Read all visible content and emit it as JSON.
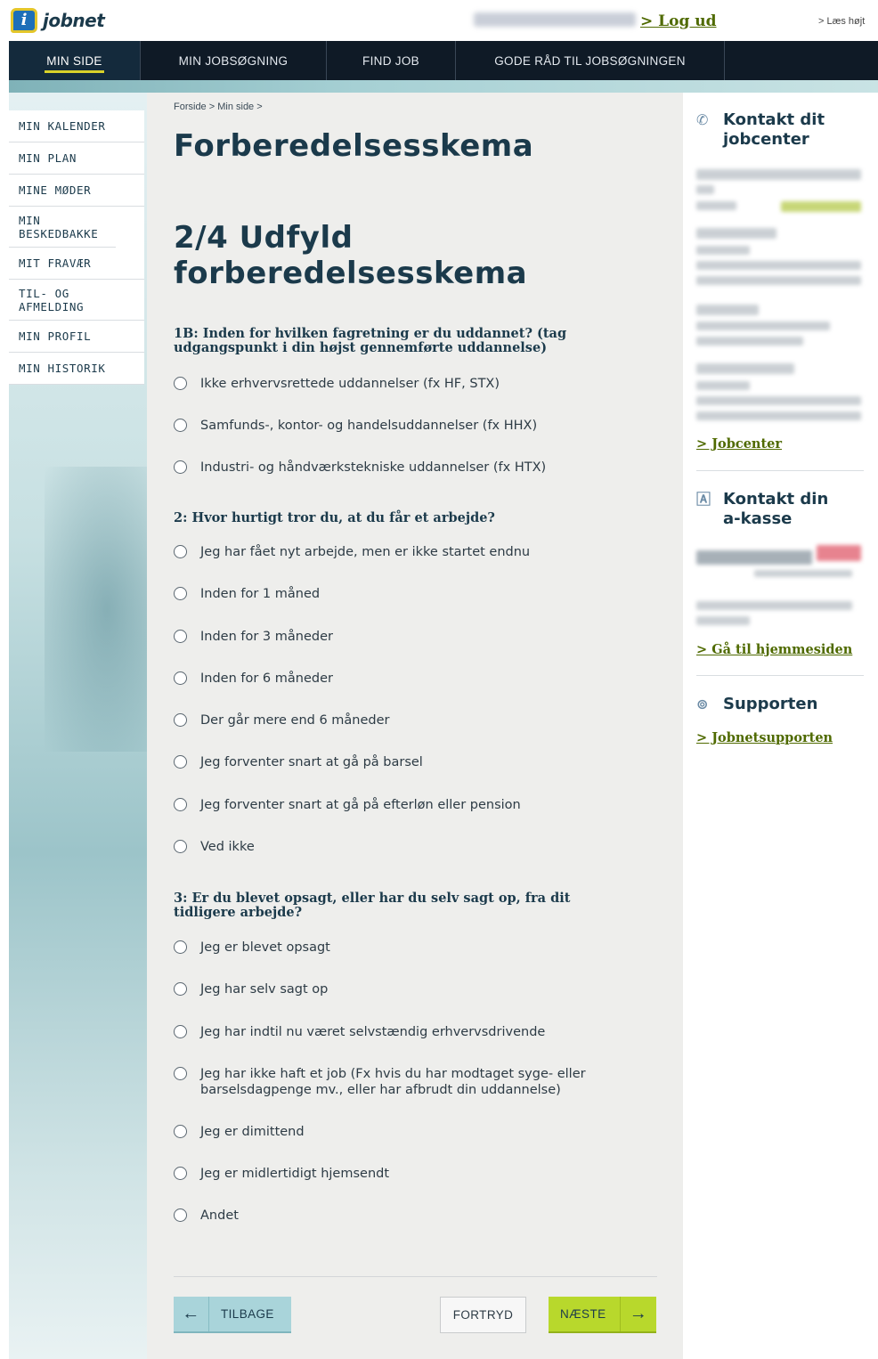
{
  "header": {
    "logo_text": "jobnet",
    "logout_label": "> Log ud",
    "read_aloud_label": "> Læs højt"
  },
  "nav": {
    "items": [
      "MIN SIDE",
      "MIN JOBSØGNING",
      "FIND JOB",
      "GODE RÅD TIL JOBSØGNINGEN"
    ],
    "active": "MIN SIDE"
  },
  "sidebar": {
    "items": [
      "MIN KALENDER",
      "MIN PLAN",
      "MINE MØDER",
      "MIN BESKEDBAKKE",
      "MIT FRAVÆR",
      "TIL- OG AFMELDING",
      "MIN PROFIL",
      "MIN HISTORIK"
    ]
  },
  "main": {
    "breadcrumb": "Forside > Min side >",
    "title": "Forberedelsesskema",
    "step_title": "2/4 Udfyld forberedelsesskema",
    "questions": [
      {
        "label": "1B: Inden for hvilken fagretning er du uddannet? (tag udgangspunkt i din højst gennemførte uddannelse)",
        "options": [
          "Ikke erhvervsrettede uddannelser (fx HF, STX)",
          "Samfunds-, kontor- og handelsuddannelser (fx HHX)",
          "Industri- og håndværkstekniske uddannelser (fx HTX)"
        ]
      },
      {
        "label": "2: Hvor hurtigt tror du, at du får et arbejde?",
        "options": [
          "Jeg har fået nyt arbejde, men er ikke startet endnu",
          "Inden for 1 måned",
          "Inden for 3 måneder",
          "Inden for 6 måneder",
          "Der går mere end 6 måneder",
          "Jeg forventer snart at gå på barsel",
          "Jeg forventer snart at gå på efterløn eller pension",
          "Ved ikke"
        ]
      },
      {
        "label": "3: Er du blevet opsagt, eller har du selv sagt op, fra dit tidligere arbejde?",
        "options": [
          "Jeg er blevet opsagt",
          "Jeg har selv sagt op",
          "Jeg har indtil nu været selvstændig erhvervsdrivende",
          "Jeg har ikke haft et job (Fx hvis du har modtaget syge- eller barselsdagpenge mv., eller har afbrudt din uddannelse)",
          "Jeg er dimittend",
          "Jeg er midlertidigt hjemsendt",
          "Andet"
        ]
      }
    ],
    "buttons": {
      "back": "TILBAGE",
      "cancel": "FORTRYD",
      "next": "NÆSTE"
    }
  },
  "right": {
    "jobcenter_heading": "Kontakt dit jobcenter",
    "jobcenter_link": "> Jobcenter",
    "akasse_heading": "Kontakt din a-kasse",
    "akasse_link": "> Gå til hjemmesiden",
    "support_heading": "Supporten",
    "support_link": "> Jobnetsupporten"
  },
  "colors": {
    "nav_bg": "#0f1a26",
    "accent_yellow": "#d9d22a",
    "link_green": "#4f6a00",
    "next_button": "#b8d82c",
    "back_button": "#a9d4da"
  }
}
